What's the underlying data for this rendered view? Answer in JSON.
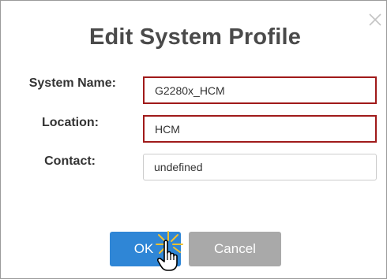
{
  "dialog": {
    "title": "Edit System Profile",
    "close_icon": "close-icon"
  },
  "form": {
    "system_name": {
      "label": "System Name:",
      "value": "G2280x_HCM",
      "state": "error"
    },
    "location": {
      "label": "Location:",
      "value": "HCM",
      "state": "error"
    },
    "contact": {
      "label": "Contact:",
      "value": "undefined",
      "state": "normal"
    }
  },
  "buttons": {
    "ok_label": "OK",
    "cancel_label": "Cancel"
  },
  "colors": {
    "accent": "#2f86d6",
    "error_border": "#a01a1a",
    "cancel_bg": "#a9a9a9",
    "title_text": "#4a4a4a"
  },
  "icons": {
    "cursor": "hand-pointer-icon",
    "click_effect": "click-burst-icon"
  }
}
